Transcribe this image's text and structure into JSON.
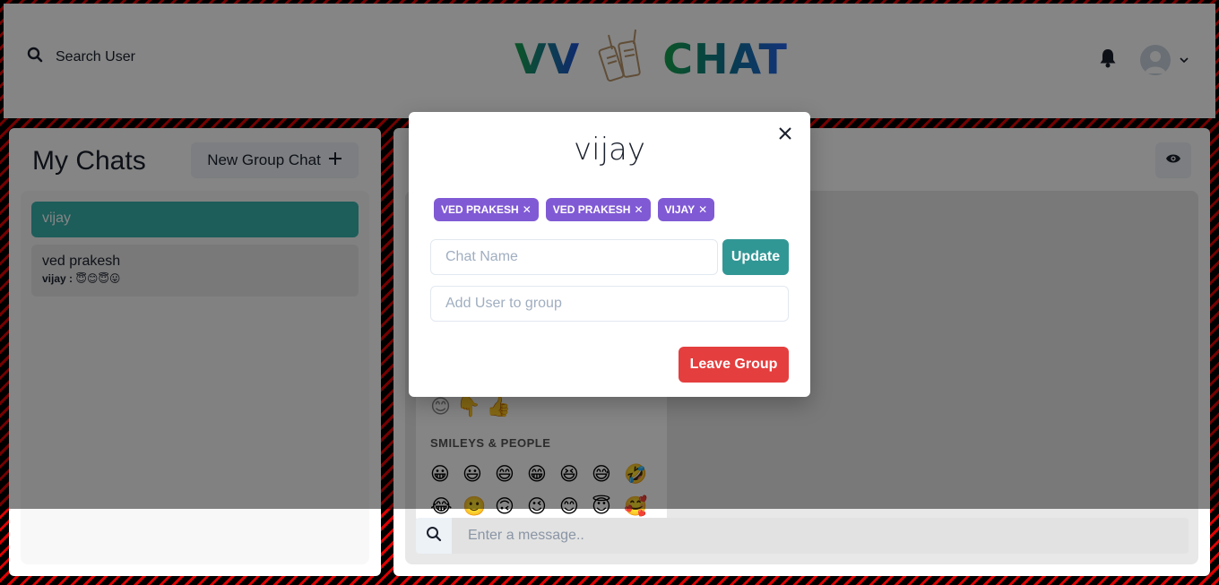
{
  "header": {
    "search_label": "Search User",
    "logo_left": "VV",
    "logo_right": "CHAT"
  },
  "left": {
    "title": "My Chats",
    "new_group_label": "New Group Chat",
    "chats": [
      {
        "name": "vijay",
        "active": true
      },
      {
        "name": "ved prakesh",
        "latest_sender": "vijay :",
        "latest_text": "😇😊😇😛"
      }
    ]
  },
  "right": {
    "emoji_picker": {
      "category_row": "😊 👇 👍",
      "heading": "SMILEYS & PEOPLE",
      "emojis": [
        "😀",
        "😃",
        "😄",
        "😁",
        "😆",
        "😅",
        "🤣",
        "😂",
        "🙂",
        "🙃",
        "😉",
        "😊",
        "😇",
        "🥰"
      ]
    },
    "message_placeholder": "Enter a message.."
  },
  "modal": {
    "title": "vijay",
    "users": [
      "VED PRAKESH",
      "VED PRAKESH",
      "VIJAY"
    ],
    "chat_name_placeholder": "Chat Name",
    "update_label": "Update",
    "add_user_placeholder": "Add User to group",
    "leave_label": "Leave Group"
  },
  "colors": {
    "accent_teal": "#38b2ac",
    "badge_purple": "#805ad5",
    "update_teal": "#319795",
    "leave_red": "#e53e3e"
  }
}
